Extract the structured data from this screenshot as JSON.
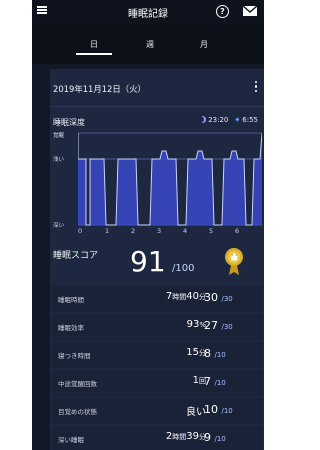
{
  "header": {
    "title": "睡眠記録",
    "help_glyph": "?"
  },
  "tabs": [
    {
      "label": "日",
      "active": true
    },
    {
      "label": "週",
      "active": false
    },
    {
      "label": "月",
      "active": false
    }
  ],
  "date": "2019年11月12日（火）",
  "depth": {
    "label": "睡眠深度",
    "bedtime": "23:20",
    "waketime": "6:55",
    "levels": [
      "覚醒",
      "浅い",
      "深い"
    ],
    "hours": [
      "0",
      "1",
      "2",
      "3",
      "4",
      "5",
      "6"
    ]
  },
  "score": {
    "label": "睡眠スコア",
    "value": "91",
    "max": "/100"
  },
  "metrics": [
    {
      "label": "睡眠時間",
      "value_big": "7",
      "value_small": "時間",
      "value_big2": "40",
      "value_small2": "分",
      "points": "30",
      "max": "/30"
    },
    {
      "label": "睡眠効率",
      "value_big": "93",
      "value_small": "%",
      "value_big2": "",
      "value_small2": "",
      "points": "27",
      "max": "/30"
    },
    {
      "label": "寝つき時間",
      "value_big": "15",
      "value_small": "分",
      "value_big2": "",
      "value_small2": "",
      "points": "8",
      "max": "/10"
    },
    {
      "label": "中途覚醒回数",
      "value_big": "1",
      "value_small": "回",
      "value_big2": "",
      "value_small2": "",
      "points": "7",
      "max": "/10"
    },
    {
      "label": "目覚めの状態",
      "value_big": "良い",
      "value_small": "",
      "value_big2": "",
      "value_small2": "",
      "points": "10",
      "max": "/10"
    },
    {
      "label": "深い睡眠",
      "value_big": "2",
      "value_small": "時間",
      "value_big2": "39",
      "value_small2": "分",
      "points": "9",
      "max": "/10"
    }
  ],
  "colors": {
    "background": "#121826",
    "card": "#1d2740",
    "chart_fill": "#3a49c9",
    "chart_line": "#c8d4ff"
  }
}
